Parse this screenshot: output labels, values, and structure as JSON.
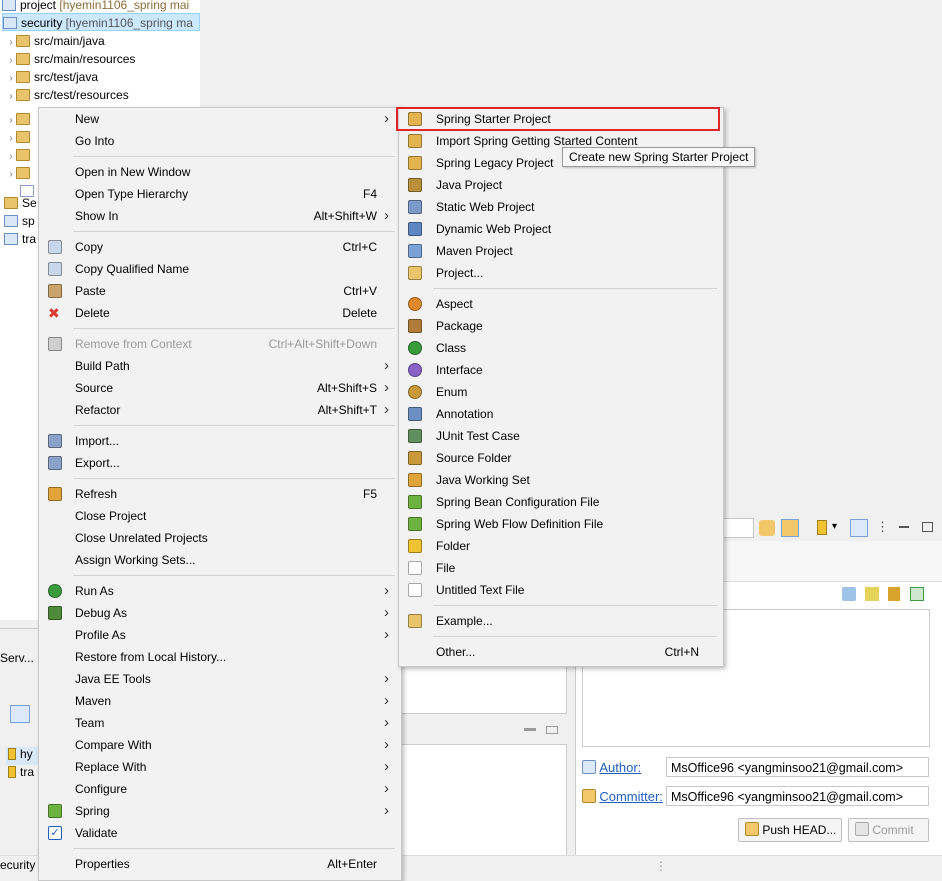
{
  "explorer": {
    "rows": [
      {
        "name": "project",
        "suffix": " [hyemin1106_spring mai"
      },
      {
        "name": "security",
        "suffix": " [hyemin1106_spring ma"
      },
      {
        "name": "src/main/java"
      },
      {
        "name": "src/main/resources"
      },
      {
        "name": "src/test/java"
      },
      {
        "name": "src/test/resources"
      },
      {
        "name": "Se"
      },
      {
        "name": "sp"
      },
      {
        "name": "tra"
      }
    ]
  },
  "left_panel": {
    "servers_tab": "Serv...",
    "items": [
      "hy",
      "tra"
    ],
    "status_left": "ecurity"
  },
  "context_menu": {
    "items": [
      {
        "label": "New",
        "submenu": true,
        "icon": ""
      },
      {
        "label": "Go Into"
      },
      {
        "sep": true
      },
      {
        "label": "Open in New Window"
      },
      {
        "label": "Open Type Hierarchy",
        "shortcut": "F4"
      },
      {
        "label": "Show In",
        "shortcut": "Alt+Shift+W",
        "submenu": true
      },
      {
        "sep": true
      },
      {
        "label": "Copy",
        "shortcut": "Ctrl+C",
        "icon": "copy-icon"
      },
      {
        "label": "Copy Qualified Name",
        "icon": "copy-qualified-icon"
      },
      {
        "label": "Paste",
        "shortcut": "Ctrl+V",
        "icon": "paste-icon"
      },
      {
        "label": "Delete",
        "shortcut": "Delete",
        "icon": "delete-icon"
      },
      {
        "sep": true
      },
      {
        "label": "Remove from Context",
        "shortcut": "Ctrl+Alt+Shift+Down",
        "disabled": true,
        "icon": "remove-context-icon"
      },
      {
        "label": "Build Path",
        "submenu": true
      },
      {
        "label": "Source",
        "shortcut": "Alt+Shift+S",
        "submenu": true
      },
      {
        "label": "Refactor",
        "shortcut": "Alt+Shift+T",
        "submenu": true
      },
      {
        "sep": true
      },
      {
        "label": "Import...",
        "icon": "import-icon"
      },
      {
        "label": "Export...",
        "icon": "export-icon"
      },
      {
        "sep": true
      },
      {
        "label": "Refresh",
        "shortcut": "F5",
        "icon": "refresh-icon"
      },
      {
        "label": "Close Project"
      },
      {
        "label": "Close Unrelated Projects"
      },
      {
        "label": "Assign Working Sets..."
      },
      {
        "sep": true
      },
      {
        "label": "Run As",
        "submenu": true,
        "icon": "run-icon"
      },
      {
        "label": "Debug As",
        "submenu": true,
        "icon": "debug-icon"
      },
      {
        "label": "Profile As",
        "submenu": true
      },
      {
        "label": "Restore from Local History..."
      },
      {
        "label": "Java EE Tools",
        "submenu": true
      },
      {
        "label": "Maven",
        "submenu": true
      },
      {
        "label": "Team",
        "submenu": true
      },
      {
        "label": "Compare With",
        "submenu": true
      },
      {
        "label": "Replace With",
        "submenu": true
      },
      {
        "label": "Configure",
        "submenu": true
      },
      {
        "label": "Spring",
        "submenu": true,
        "icon": "spring-icon"
      },
      {
        "label": "Validate",
        "icon": "validate-check-icon"
      },
      {
        "sep": true
      },
      {
        "label": "Properties",
        "shortcut": "Alt+Enter"
      }
    ]
  },
  "new_submenu": {
    "items": [
      {
        "label": "Spring Starter Project",
        "icon": "spring-starter-icon",
        "highlight": true
      },
      {
        "label": "Import Spring Getting Started Content",
        "icon": "spring-import-icon"
      },
      {
        "label": "Spring Legacy Project",
        "icon": "spring-legacy-icon"
      },
      {
        "label": "Java Project",
        "icon": "java-project-icon"
      },
      {
        "label": "Static Web Project",
        "icon": "static-web-icon"
      },
      {
        "label": "Dynamic Web Project",
        "icon": "dynamic-web-icon"
      },
      {
        "label": "Maven Project",
        "icon": "maven-project-icon"
      },
      {
        "label": "Project...",
        "icon": "project-icon"
      },
      {
        "sep": true
      },
      {
        "label": "Aspect",
        "icon": "aspect-icon"
      },
      {
        "label": "Package",
        "icon": "package-icon"
      },
      {
        "label": "Class",
        "icon": "class-icon"
      },
      {
        "label": "Interface",
        "icon": "interface-icon"
      },
      {
        "label": "Enum",
        "icon": "enum-icon"
      },
      {
        "label": "Annotation",
        "icon": "annotation-icon"
      },
      {
        "label": "JUnit Test Case",
        "icon": "junit-icon"
      },
      {
        "label": "Source Folder",
        "icon": "source-folder-icon"
      },
      {
        "label": "Java Working Set",
        "icon": "working-set-icon"
      },
      {
        "label": "Spring Bean Configuration File",
        "icon": "spring-bean-icon"
      },
      {
        "label": "Spring Web Flow Definition File",
        "icon": "spring-webflow-icon"
      },
      {
        "label": "Folder",
        "icon": "folder-icon"
      },
      {
        "label": "File",
        "icon": "file-icon"
      },
      {
        "label": "Untitled Text File",
        "icon": "text-file-icon"
      },
      {
        "sep": true
      },
      {
        "label": "Example...",
        "icon": "example-icon"
      },
      {
        "sep": true
      },
      {
        "label": "Other...",
        "shortcut": "Ctrl+N"
      }
    ]
  },
  "tooltip": "Create new Spring Starter Project",
  "git_panel": {
    "author_label": "Author:",
    "author_value": "MsOffice96 <yangminsoo21@gmail.com>",
    "committer_label": "Committer:",
    "committer_value": "MsOffice96 <yangminsoo21@gmail.com>",
    "push_label": "Push HEAD...",
    "commit_label": "Commit"
  },
  "colors": {
    "highlight_border": "#e0262a",
    "selection_bg": "#cce8ff",
    "link": "#1f5fbf"
  }
}
